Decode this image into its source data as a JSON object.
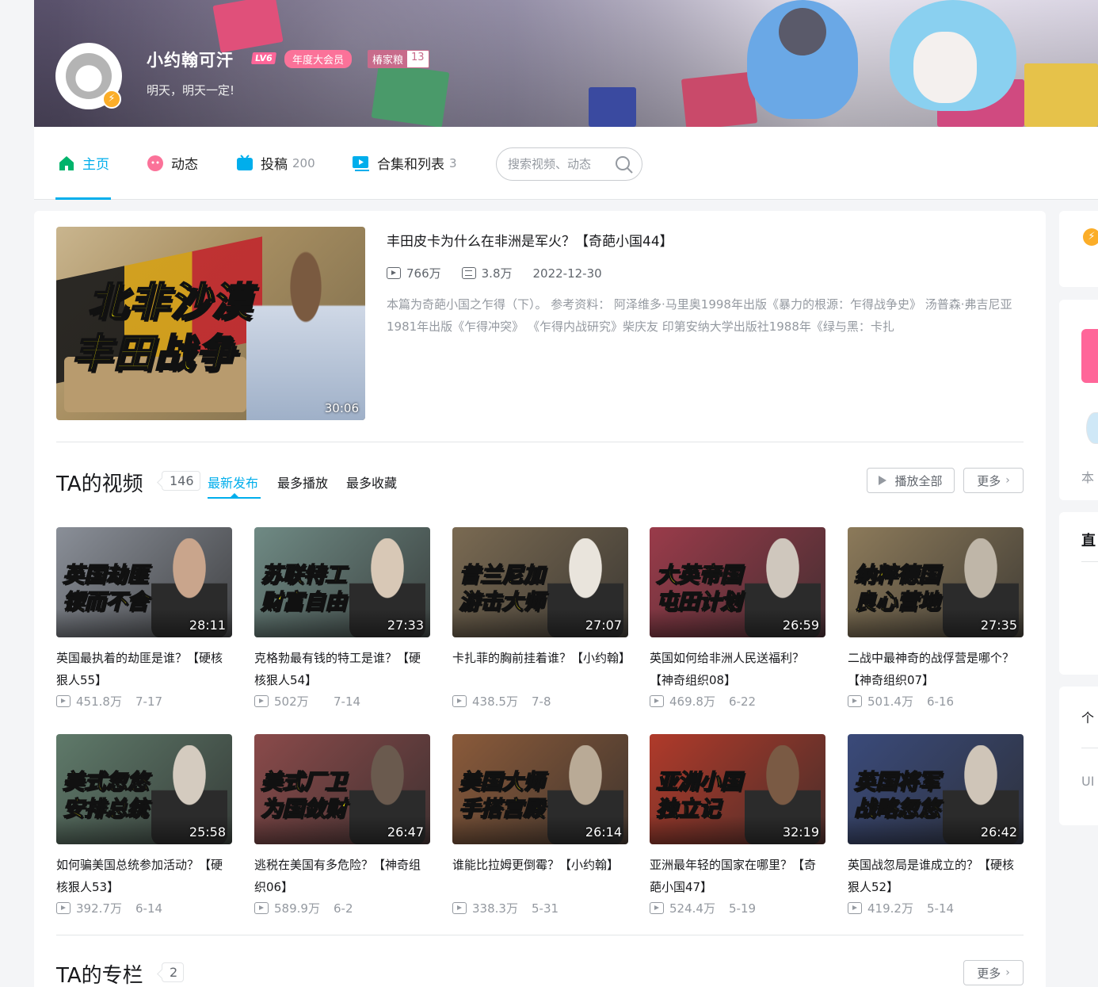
{
  "profile": {
    "name": "小约翰可汗",
    "level": "LV6",
    "vip": "年度大会员",
    "medal_name": "椿家粮",
    "medal_level": "13",
    "sign": "明天，明天一定!"
  },
  "nav": {
    "home": "主页",
    "dynamic": "动态",
    "upload": "投稿",
    "upload_count": "200",
    "collections": "合集和列表",
    "collections_count": "3",
    "search_placeholder": "搜索视频、动态"
  },
  "featured": {
    "title": "丰田皮卡为什么在非洲是军火？【奇葩小国44】",
    "views": "766万",
    "danmaku": "3.8万",
    "date": "2022-12-30",
    "desc": "本篇为奇葩小国之乍得（下）。 参考资料： 阿泽维多·马里奥1998年出版《暴力的根源：乍得战争史》 汤普森·弗吉尼亚1981年出版《乍得冲突》 《乍得内战研究》柴庆友 印第安纳大学出版社1988年《绿与黑：卡扎",
    "thumb_line1": "北非沙漠",
    "thumb_line2": "丰田战争",
    "duration": "30:06"
  },
  "videos_section": {
    "title": "TA的视频",
    "count": "146",
    "tabs": [
      "最新发布",
      "最多播放",
      "最多收藏"
    ],
    "play_all": "播放全部",
    "more": "更多"
  },
  "videos": [
    {
      "line1": "英国劫匪",
      "line2": "锲而不舍",
      "duration": "28:11",
      "title": "英国最执着的劫匪是谁？【硬核狠人55】",
      "views": "451.8万",
      "date": "7-17",
      "bg": "#8a8f98",
      "portrait": "#c9a58c"
    },
    {
      "line1": "苏联特工",
      "line2": "财富自由",
      "duration": "27:33",
      "title": "克格勃最有钱的特工是谁？【硬核狠人54】",
      "views": "502万",
      "date": "7-14",
      "bg": "#6f8a84",
      "portrait": "#d8c8b6"
    },
    {
      "line1": "昔兰尼加",
      "line2": "游击大师",
      "duration": "27:07",
      "title": "卡扎菲的胸前挂着谁？【小约翰】",
      "views": "438.5万",
      "date": "7-8",
      "bg": "#7a6a52",
      "portrait": "#e9e4dc"
    },
    {
      "line1": "大英帝国",
      "line2": "屯田计划",
      "duration": "26:59",
      "title": "英国如何给非洲人民送福利？【神奇组织08】",
      "views": "469.8万",
      "date": "6-22",
      "bg": "#9a3b4a",
      "portrait": "#cfc7bd"
    },
    {
      "line1": "纳粹德国",
      "line2": "良心营地",
      "duration": "27:35",
      "title": "二战中最神奇的战俘营是哪个？【神奇组织07】",
      "views": "501.4万",
      "date": "6-16",
      "bg": "#8c7a5a",
      "portrait": "#bfb6a8"
    },
    {
      "line1": "美式忽悠",
      "line2": "安排总统",
      "duration": "25:58",
      "title": "如何骗美国总统参加活动？【硬核狠人53】",
      "views": "392.7万",
      "date": "6-14",
      "bg": "#5f7a6a",
      "portrait": "#d4cbbf"
    },
    {
      "line1": "美式厂卫",
      "line2": "为国敛财",
      "duration": "26:47",
      "title": "逃税在美国有多危险？【神奇组织06】",
      "views": "589.9万",
      "date": "6-2",
      "bg": "#8a4a4a",
      "portrait": "#6a5a4e"
    },
    {
      "line1": "美国大师",
      "line2": "手搭宫殿",
      "duration": "26:14",
      "title": "谁能比拉姆更倒霉？【小约翰】",
      "views": "338.3万",
      "date": "5-31",
      "bg": "#8a5a3a",
      "portrait": "#b9aa96"
    },
    {
      "line1": "亚洲小国",
      "line2": "独立记",
      "duration": "32:19",
      "title": "亚洲最年轻的国家在哪里？【奇葩小国47】",
      "views": "524.4万",
      "date": "5-19",
      "bg": "#b03a2a",
      "portrait": "#7a5a44"
    },
    {
      "line1": "英国将军",
      "line2": "战略忽悠",
      "duration": "26:42",
      "title": "英国战忽局是谁成立的？【硬核狠人52】",
      "views": "419.2万",
      "date": "5-14",
      "bg": "#3a4a7a",
      "portrait": "#cfc5b8"
    }
  ],
  "column_section": {
    "title": "TA的专栏",
    "count": "2",
    "more": "更多"
  },
  "right": {
    "text1": "本",
    "bold1": "直",
    "text2": "个",
    "text3": "UI"
  },
  "colors": {
    "accent": "#00aeec",
    "pink": "#fb7299"
  }
}
